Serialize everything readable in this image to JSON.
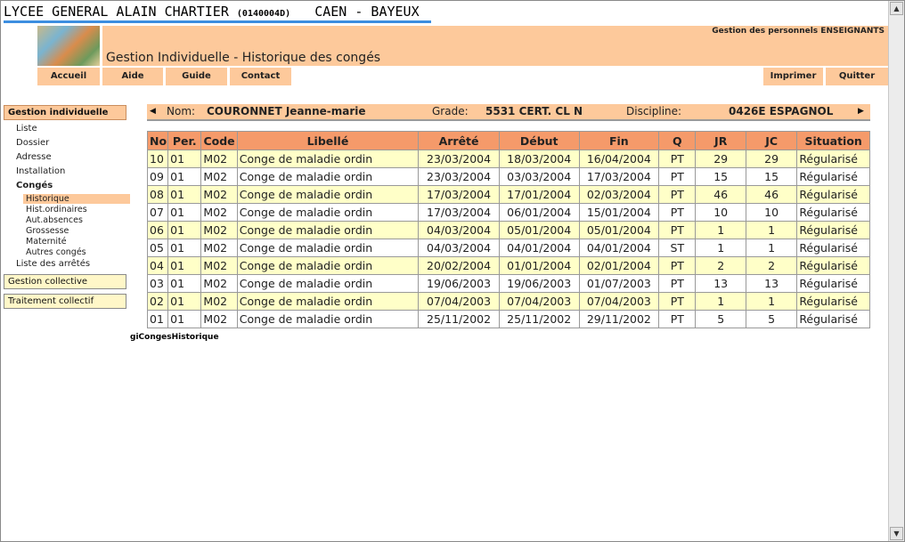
{
  "school": {
    "name": "LYCEE GENERAL ALAIN CHARTIER",
    "code": "(0140004D)",
    "city": "CAEN - BAYEUX"
  },
  "header": {
    "subtitle": "Gestion des personnels ENSEIGNANTS",
    "title": "Gestion Individuelle - Historique des congés"
  },
  "topnav": {
    "accueil": "Accueil",
    "aide": "Aide",
    "guide": "Guide",
    "contact": "Contact",
    "imprimer": "Imprimer",
    "quitter": "Quitter"
  },
  "sidebar": {
    "gestion_individuelle": "Gestion individuelle",
    "items": [
      "Liste",
      "Dossier",
      "Adresse",
      "Installation"
    ],
    "conges": "Congés",
    "conges_items": [
      "Historique",
      "Hist.ordinaires",
      "Aut.absences",
      "Grossesse",
      "Maternité",
      "Autres congés"
    ],
    "liste_arretes": "Liste des arrêtés",
    "gestion_collective": "Gestion collective",
    "traitement_collectif": "Traitement collectif"
  },
  "infobar": {
    "nom_label": "Nom:",
    "nom_value": "COURONNET Jeanne-marie",
    "grade_label": "Grade:",
    "grade_value": "5531 CERT. CL N",
    "discipline_label": "Discipline:",
    "discipline_value": "0426E ESPAGNOL"
  },
  "table": {
    "columns": [
      "No",
      "Per.",
      "Code",
      "Libellé",
      "Arrêté",
      "Début",
      "Fin",
      "Q",
      "JR",
      "JC",
      "Situation"
    ],
    "rows": [
      [
        "10",
        "01",
        "M02",
        "Conge de maladie ordin",
        "23/03/2004",
        "18/03/2004",
        "16/04/2004",
        "PT",
        "29",
        "29",
        "Régularisé"
      ],
      [
        "09",
        "01",
        "M02",
        "Conge de maladie ordin",
        "23/03/2004",
        "03/03/2004",
        "17/03/2004",
        "PT",
        "15",
        "15",
        "Régularisé"
      ],
      [
        "08",
        "01",
        "M02",
        "Conge de maladie ordin",
        "17/03/2004",
        "17/01/2004",
        "02/03/2004",
        "PT",
        "46",
        "46",
        "Régularisé"
      ],
      [
        "07",
        "01",
        "M02",
        "Conge de maladie ordin",
        "17/03/2004",
        "06/01/2004",
        "15/01/2004",
        "PT",
        "10",
        "10",
        "Régularisé"
      ],
      [
        "06",
        "01",
        "M02",
        "Conge de maladie ordin",
        "04/03/2004",
        "05/01/2004",
        "05/01/2004",
        "PT",
        "1",
        "1",
        "Régularisé"
      ],
      [
        "05",
        "01",
        "M02",
        "Conge de maladie ordin",
        "04/03/2004",
        "04/01/2004",
        "04/01/2004",
        "ST",
        "1",
        "1",
        "Régularisé"
      ],
      [
        "04",
        "01",
        "M02",
        "Conge de maladie ordin",
        "20/02/2004",
        "01/01/2004",
        "02/01/2004",
        "PT",
        "2",
        "2",
        "Régularisé"
      ],
      [
        "03",
        "01",
        "M02",
        "Conge de maladie ordin",
        "19/06/2003",
        "19/06/2003",
        "01/07/2003",
        "PT",
        "13",
        "13",
        "Régularisé"
      ],
      [
        "02",
        "01",
        "M02",
        "Conge de maladie ordin",
        "07/04/2003",
        "07/04/2003",
        "07/04/2003",
        "PT",
        "1",
        "1",
        "Régularisé"
      ],
      [
        "01",
        "01",
        "M02",
        "Conge de maladie ordin",
        "25/11/2002",
        "25/11/2002",
        "29/11/2002",
        "PT",
        "5",
        "5",
        "Régularisé"
      ]
    ]
  },
  "footer_label": "giCongesHistorique",
  "colors": {
    "accent_orange": "#fdc99b",
    "table_header": "#f59a6a",
    "row_alt": "#ffffc8",
    "title_underline": "#3d8ee0"
  }
}
